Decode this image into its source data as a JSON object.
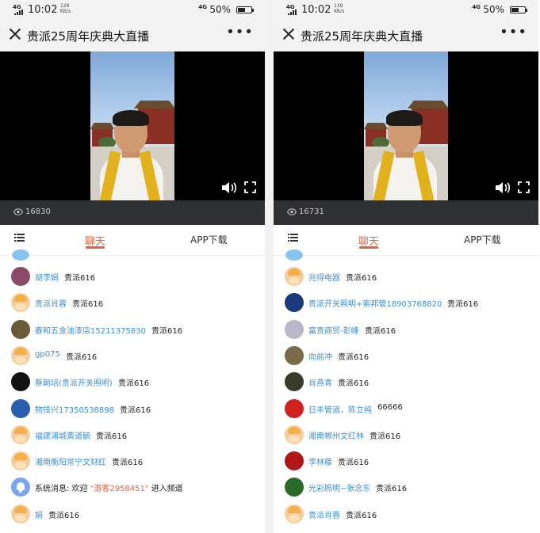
{
  "colors": {
    "accent": "#e8603c",
    "link": "#3d8fd2",
    "videoBg": "#000000",
    "viewBar": "#2f3034"
  },
  "screens": [
    {
      "status": {
        "network_top": "4G",
        "network_bottom": "",
        "time": "10:02",
        "speed_top": "129",
        "speed_bottom": "KB/s",
        "net_label": "4G",
        "battery": "50%"
      },
      "title": "贵派25周年庆典大直播",
      "more": "•••",
      "views": "16830",
      "tabs": {
        "chat": "聊天",
        "app": "APP下载"
      },
      "messages": [
        {
          "avatar": "photo",
          "avatar_color": "#8a4a6a",
          "name": "胡李娟",
          "text": "贵派616"
        },
        {
          "avatar": "cartoon",
          "name": "贵派肖蓉",
          "text": "贵派616"
        },
        {
          "avatar": "photo",
          "avatar_color": "#6a5a3a",
          "name": "春和五金油漆店15211375830",
          "text": "贵派616"
        },
        {
          "avatar": "cartoon",
          "name": "gp075",
          "text": "贵派616"
        },
        {
          "avatar": "photo",
          "avatar_color": "#111111",
          "name": "蔡朝培(贵派开关照明)",
          "text": "贵派616"
        },
        {
          "avatar": "photo",
          "avatar_color": "#2a5fb0",
          "name": "物技兴17350538898",
          "text": "贵派616"
        },
        {
          "avatar": "cartoon",
          "name": "福建浦城黄道毓",
          "text": "贵派616"
        },
        {
          "avatar": "cartoon",
          "name": "湘南衡阳常宁文财红",
          "text": "贵派616"
        },
        {
          "avatar": "system",
          "system": true,
          "prefix": "系统消息:  欢迎",
          "name": "\"游客2958451\"",
          "suffix": "进入频道"
        },
        {
          "avatar": "cartoon",
          "name": "娟",
          "text": "贵派616"
        }
      ]
    },
    {
      "status": {
        "network_top": "4G",
        "network_bottom": "",
        "time": "10:02",
        "speed_top": "139",
        "speed_bottom": "KB/s",
        "net_label": "4G",
        "battery": "50%"
      },
      "title": "贵派25周年庆典大直播",
      "more": "•••",
      "views": "16731",
      "tabs": {
        "chat": "聊天",
        "app": "APP下载"
      },
      "messages": [
        {
          "avatar": "cartoon",
          "name": "兆得电器",
          "text": "贵派616"
        },
        {
          "avatar": "photo",
          "avatar_color": "#1a3a7a",
          "name": "贵派开关照明+索邦管18903768820",
          "text": "贵派616"
        },
        {
          "avatar": "photo",
          "avatar_color": "#b8b8c8",
          "name": "富贵商贸-彭峰",
          "text": "贵派616"
        },
        {
          "avatar": "photo",
          "avatar_color": "#7a6a4a",
          "name": "向前冲",
          "text": "贵派616"
        },
        {
          "avatar": "photo",
          "avatar_color": "#3a3a2a",
          "name": "肖燕青",
          "text": "贵派616"
        },
        {
          "avatar": "photo",
          "avatar_color": "#d02020",
          "name": "日丰管道，陈立纯",
          "text": "66666"
        },
        {
          "avatar": "cartoon",
          "name": "湘南郴州文红林",
          "text": "贵派616"
        },
        {
          "avatar": "photo",
          "avatar_color": "#b01818",
          "name": "李林藤",
          "text": "贵派616"
        },
        {
          "avatar": "photo",
          "avatar_color": "#2a6a2a",
          "name": "光彩照明~张念东",
          "text": "贵派616"
        },
        {
          "avatar": "cartoon",
          "name": "贵派肖蓉",
          "text": "贵派616"
        }
      ]
    }
  ]
}
